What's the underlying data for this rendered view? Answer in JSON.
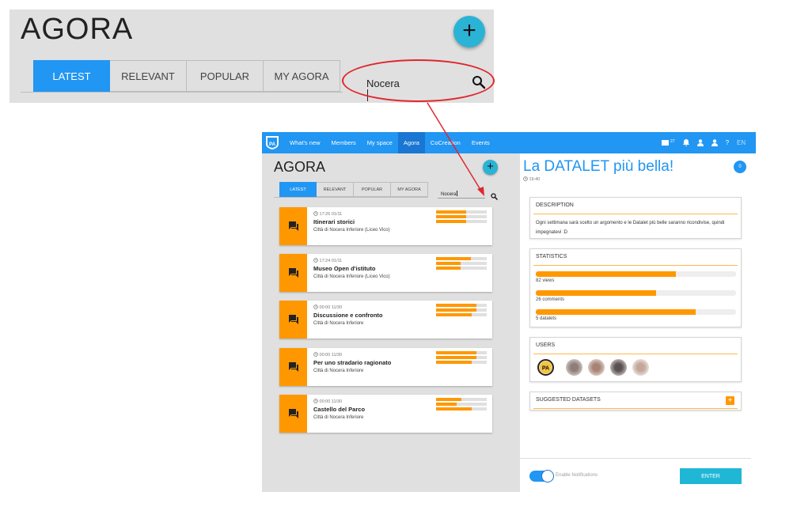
{
  "colors": {
    "accent": "#2196f3",
    "fab": "#2bb3d6",
    "orange": "#ff9800",
    "annotation_red": "#e0272e",
    "enter": "#20b7d6"
  },
  "zoom": {
    "title": "AGORA",
    "fab_label": "+",
    "tabs": [
      {
        "label": "LATEST",
        "active": true
      },
      {
        "label": "RELEVANT"
      },
      {
        "label": "POPULAR"
      },
      {
        "label": "MY AGORA"
      }
    ],
    "search_value": "Nocera",
    "search_icon": "search-icon"
  },
  "app": {
    "nav": {
      "items": [
        {
          "label": "What's new"
        },
        {
          "label": "Members"
        },
        {
          "label": "My space"
        },
        {
          "label": "Agora",
          "active": true
        },
        {
          "label": "CoCreation"
        },
        {
          "label": "Events"
        }
      ],
      "notification_count": "27",
      "help_label": "?",
      "language": "EN"
    },
    "agora": {
      "title": "AGORA",
      "fab_label": "+",
      "tabs": [
        {
          "label": "LATEST",
          "active": true
        },
        {
          "label": "RELEVANT"
        },
        {
          "label": "POPULAR"
        },
        {
          "label": "MY AGORA"
        }
      ],
      "search_value": "Nocera",
      "cards": [
        {
          "time": "17:26 01/11",
          "title": "Itinerari storici",
          "subtitle": "Città di Nocera Inferiore (Liceo Vico)",
          "bars": [
            0.6,
            0.6,
            0.6
          ]
        },
        {
          "time": "17:24 01/11",
          "title": "Museo Open d'istituto",
          "subtitle": "Città di Nocera Inferiore (Liceo Vico)",
          "bars": [
            0.68,
            0.48,
            0.48
          ]
        },
        {
          "time": "00:00 11/30",
          "title": "Discussione e confronto",
          "subtitle": "Città di Nocera Inferiore",
          "bars": [
            0.8,
            0.8,
            0.7
          ]
        },
        {
          "time": "00:00 11/30",
          "title": "Per uno stradario ragionato",
          "subtitle": "Città di Nocera Inferiore",
          "bars": [
            0.8,
            0.8,
            0.7
          ]
        },
        {
          "time": "00:00 11/30",
          "title": "Castello del Parco",
          "subtitle": "Città di Nocera Inferiore",
          "bars": [
            0.5,
            0.4,
            0.7
          ]
        }
      ]
    },
    "detail": {
      "title": "La DATALET più bella!",
      "time": "16:40",
      "badge": "0",
      "description_heading": "DESCRIPTION",
      "description_text": "Ogni settimana sarà scelto un argomento e le Datalet più belle saranno ricondivise, quindi impegnatevi :D",
      "statistics_heading": "STATISTICS",
      "stats": [
        {
          "label": "82 views",
          "fill": 0.7
        },
        {
          "label": "26 comments",
          "fill": 0.6
        },
        {
          "label": "5 datalets",
          "fill": 0.8
        }
      ],
      "users_heading": "USERS",
      "suggested_heading": "SUGGESTED DATASETS",
      "suggested_plus": "+",
      "notifications_label": "Enable Notifications",
      "enter_label": "ENTER"
    }
  }
}
